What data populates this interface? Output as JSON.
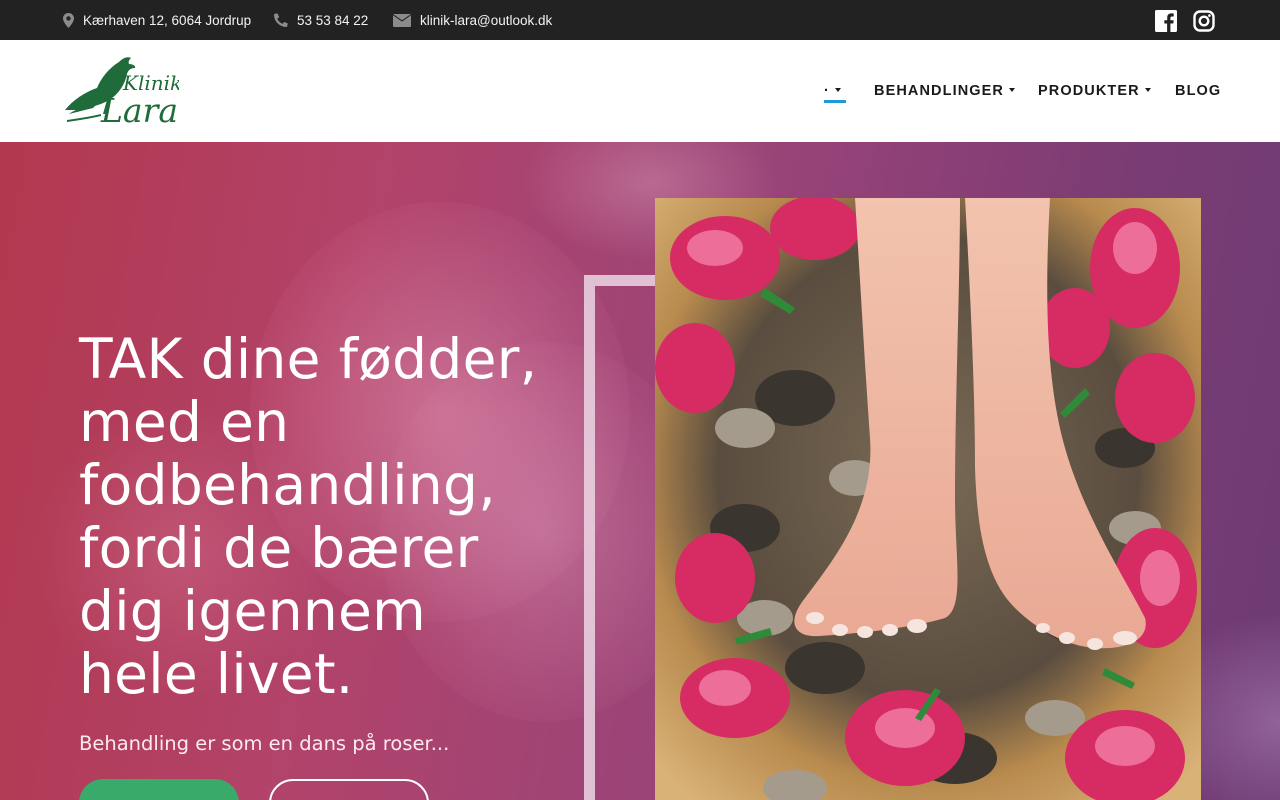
{
  "topbar": {
    "address": "Kærhaven 12, 6064 Jordrup",
    "phone": "53 53 84 22",
    "email": "klinik-lara@outlook.dk",
    "social": [
      "facebook-icon",
      "instagram-icon"
    ]
  },
  "logo": {
    "line1": "Klinik",
    "line2": "Lara",
    "color": "#1f6b3a"
  },
  "nav": {
    "home_label": "·",
    "items": [
      {
        "label": "BEHANDLINGER",
        "has_dropdown": true
      },
      {
        "label": "PRODUKTER",
        "has_dropdown": true
      },
      {
        "label": "BLOG",
        "has_dropdown": false
      }
    ],
    "active_color": "#1e9ad6"
  },
  "hero": {
    "title": "TAK dine fødder, med en fodbehandling, fordi de bærer dig igennem hele livet.",
    "subtitle": "Behandling er som en dans på roser...",
    "primary_button": "",
    "secondary_button": "",
    "primary_color": "#3aaa6a",
    "image_icon": "feet-in-rose-bowl-photo"
  }
}
